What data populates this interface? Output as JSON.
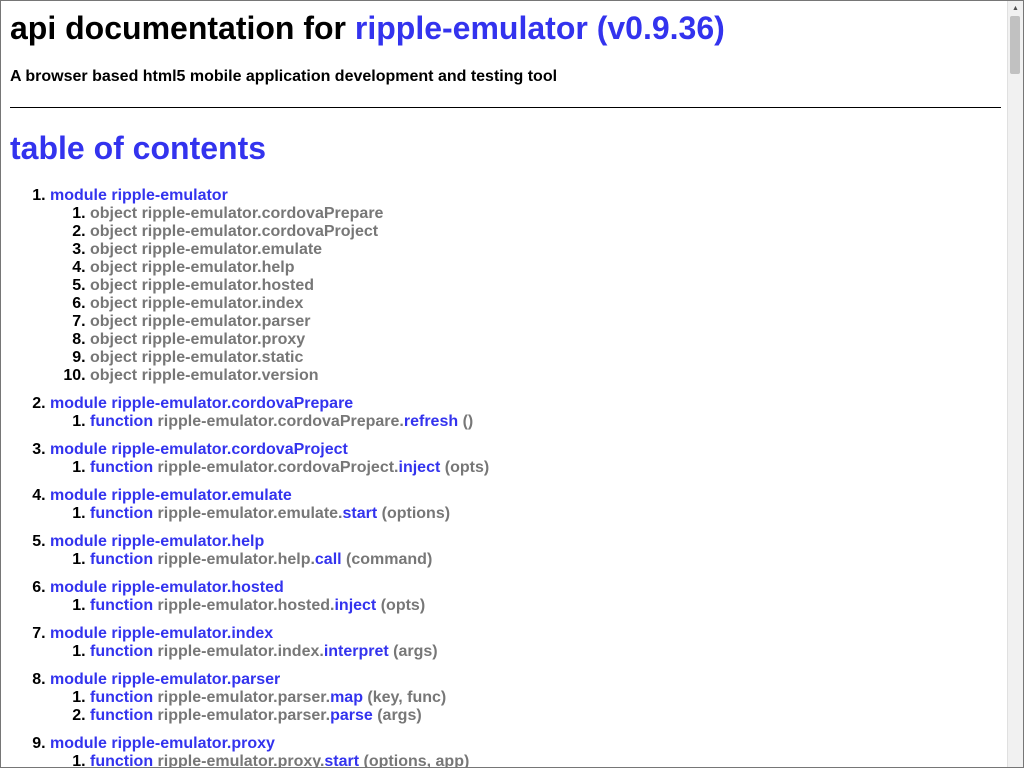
{
  "header": {
    "title_prefix": "api documentation for ",
    "package_name": "ripple-emulator (v0.9.36)",
    "tagline": "A browser based html5 mobile application development and testing tool"
  },
  "toc": {
    "heading": "table of contents",
    "modules": [
      {
        "label": "module ripple-emulator",
        "items": [
          {
            "kw": "object",
            "path": "ripple-emulator.cordovaPrepare"
          },
          {
            "kw": "object",
            "path": "ripple-emulator.cordovaProject"
          },
          {
            "kw": "object",
            "path": "ripple-emulator.emulate"
          },
          {
            "kw": "object",
            "path": "ripple-emulator.help"
          },
          {
            "kw": "object",
            "path": "ripple-emulator.hosted"
          },
          {
            "kw": "object",
            "path": "ripple-emulator.index"
          },
          {
            "kw": "object",
            "path": "ripple-emulator.parser"
          },
          {
            "kw": "object",
            "path": "ripple-emulator.proxy"
          },
          {
            "kw": "object",
            "path": "ripple-emulator.static"
          },
          {
            "kw": "object",
            "path": "ripple-emulator.version"
          }
        ]
      },
      {
        "label": "module ripple-emulator.cordovaPrepare",
        "items": [
          {
            "kw": "function",
            "path": "ripple-emulator.cordovaPrepare.",
            "name": "refresh",
            "args": "()"
          }
        ]
      },
      {
        "label": "module ripple-emulator.cordovaProject",
        "items": [
          {
            "kw": "function",
            "path": "ripple-emulator.cordovaProject.",
            "name": "inject",
            "args": "(opts)"
          }
        ]
      },
      {
        "label": "module ripple-emulator.emulate",
        "items": [
          {
            "kw": "function",
            "path": "ripple-emulator.emulate.",
            "name": "start",
            "args": "(options)"
          }
        ]
      },
      {
        "label": "module ripple-emulator.help",
        "items": [
          {
            "kw": "function",
            "path": "ripple-emulator.help.",
            "name": "call",
            "args": "(command)"
          }
        ]
      },
      {
        "label": "module ripple-emulator.hosted",
        "items": [
          {
            "kw": "function",
            "path": "ripple-emulator.hosted.",
            "name": "inject",
            "args": "(opts)"
          }
        ]
      },
      {
        "label": "module ripple-emulator.index",
        "items": [
          {
            "kw": "function",
            "path": "ripple-emulator.index.",
            "name": "interpret",
            "args": "(args)"
          }
        ]
      },
      {
        "label": "module ripple-emulator.parser",
        "items": [
          {
            "kw": "function",
            "path": "ripple-emulator.parser.",
            "name": "map",
            "args": "(key, func)"
          },
          {
            "kw": "function",
            "path": "ripple-emulator.parser.",
            "name": "parse",
            "args": "(args)"
          }
        ]
      },
      {
        "label": "module ripple-emulator.proxy",
        "items": [
          {
            "kw": "function",
            "path": "ripple-emulator.proxy.",
            "name": "start",
            "args": "(options, app)"
          }
        ]
      }
    ]
  },
  "colors": {
    "link": "#3333ee",
    "muted": "#777777"
  },
  "icons": {
    "scroll_up": "chevron-up-icon"
  }
}
